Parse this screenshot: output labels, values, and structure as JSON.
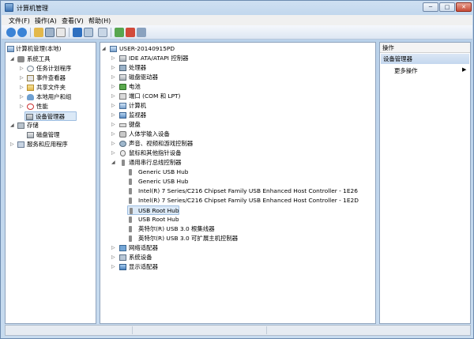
{
  "window": {
    "title": "计算机管理"
  },
  "window_controls": {
    "minimize": "─",
    "maximize": "□",
    "close": "✕"
  },
  "menu": [
    "文件(F)",
    "操作(A)",
    "查看(V)",
    "帮助(H)"
  ],
  "toolbar": {
    "icons": [
      "back-icon",
      "forward-icon",
      "up-folder-icon",
      "show-hide-tree-icon",
      "properties-icon",
      "help-icon",
      "console-icon",
      "scan-hardware-icon",
      "update-driver-icon",
      "uninstall-icon",
      "disable-icon"
    ]
  },
  "console_tree": {
    "root": "计算机管理(本地)",
    "items": [
      {
        "label": "系统工具",
        "level": 1,
        "expanded": true,
        "icon": "tools-icon"
      },
      {
        "label": "任务计划程序",
        "level": 2,
        "icon": "task-scheduler-icon"
      },
      {
        "label": "事件查看器",
        "level": 2,
        "icon": "event-viewer-icon"
      },
      {
        "label": "共享文件夹",
        "level": 2,
        "icon": "shared-folder-icon"
      },
      {
        "label": "本地用户和组",
        "level": 2,
        "icon": "users-icon"
      },
      {
        "label": "性能",
        "level": 2,
        "icon": "performance-icon"
      },
      {
        "label": "设备管理器",
        "level": 2,
        "icon": "device-manager-icon",
        "selected": true
      },
      {
        "label": "存储",
        "level": 1,
        "expanded": true,
        "icon": "storage-icon"
      },
      {
        "label": "磁盘管理",
        "level": 2,
        "icon": "disk-management-icon"
      },
      {
        "label": "服务和应用程序",
        "level": 1,
        "icon": "services-icon"
      }
    ]
  },
  "device_tree": {
    "root": "USER-20140915PD",
    "categories": [
      {
        "label": "IDE ATA/ATAPI 控制器",
        "icon": "ide-controller-icon"
      },
      {
        "label": "处理器",
        "icon": "processor-icon"
      },
      {
        "label": "磁盘驱动器",
        "icon": "disk-drive-icon"
      },
      {
        "label": "电池",
        "icon": "battery-icon"
      },
      {
        "label": "端口 (COM 和 LPT)",
        "icon": "port-icon"
      },
      {
        "label": "计算机",
        "icon": "computer-icon"
      },
      {
        "label": "监视器",
        "icon": "monitor-icon"
      },
      {
        "label": "键盘",
        "icon": "keyboard-icon"
      },
      {
        "label": "人体学输入设备",
        "icon": "hid-icon"
      },
      {
        "label": "声音、视频和游戏控制器",
        "icon": "audio-icon"
      },
      {
        "label": "鼠标和其他指针设备",
        "icon": "mouse-icon"
      },
      {
        "label": "通用串行总线控制器",
        "icon": "usb-controller-icon",
        "expanded": true
      }
    ],
    "usb_devices": [
      "Generic USB Hub",
      "Generic USB Hub",
      "Intel(R) 7 Series/C216 Chipset Family USB Enhanced Host Controller - 1E26",
      "Intel(R) 7 Series/C216 Chipset Family USB Enhanced Host Controller - 1E2D",
      "USB Root Hub",
      "USB Root Hub",
      "英特尔(R) USB 3.0 根集线器",
      "英特尔(R) USB 3.0 可扩展主机控制器"
    ],
    "selected_usb_index": 4,
    "trailing_categories": [
      {
        "label": "网络适配器",
        "icon": "network-adapter-icon"
      },
      {
        "label": "系统设备",
        "icon": "system-device-icon"
      },
      {
        "label": "显示适配器",
        "icon": "display-adapter-icon"
      }
    ]
  },
  "actions": {
    "header": "操作",
    "section": "设备管理器",
    "more": "更多操作",
    "more_arrow": "▶"
  }
}
